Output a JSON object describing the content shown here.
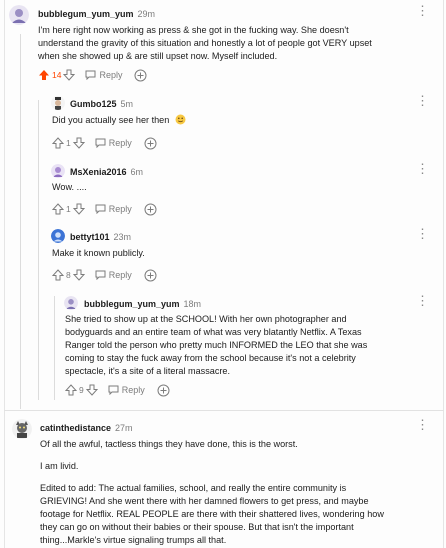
{
  "colors": {
    "upvote_active": "#ff4500",
    "meta": "#7c7c7c",
    "text": "#1c1c1c"
  },
  "icons": [
    "upvote-icon",
    "downvote-icon",
    "reply-bubble-icon",
    "award-icon",
    "more-options-icon"
  ],
  "comments": [
    {
      "user": "bubblegum_yum_yum",
      "age": "29m",
      "lines": [
        "I'm here right now working as press & she got in the fucking way. She doesn't",
        "understand the gravity of this situation and honestly a lot of people got VERY upset",
        "when she showed up & are still upset now. Myself included."
      ],
      "score": "14",
      "reply_label": "Reply"
    },
    {
      "user": "Gumbo125",
      "age": "5m",
      "lines": [
        "Did you actually see her then"
      ],
      "score": "1",
      "reply_label": "Reply"
    },
    {
      "user": "MsXenia2016",
      "age": "6m",
      "lines": [
        "Wow. ...."
      ],
      "score": "1",
      "reply_label": "Reply"
    },
    {
      "user": "bettyt101",
      "age": "23m",
      "lines": [
        "Make it known publicly."
      ],
      "score": "8",
      "reply_label": "Reply"
    },
    {
      "user": "bubblegum_yum_yum",
      "age": "18m",
      "lines": [
        "She tried to show up at the SCHOOL! With her own photographer and",
        "bodyguards and an entire team of what was very blatantly Netflix. A Texas",
        "Ranger told the person who pretty much INFORMED the LEO that she was",
        "coming to stay the fuck away from the school because it's not a celebrity",
        "spectacle, it's a site of a literal massacre."
      ],
      "score": "9",
      "reply_label": "Reply"
    },
    {
      "user": "catinthedistance",
      "age": "27m",
      "paragraphs": [
        "Of all the awful, tactless things they have done, this is the worst.",
        "I am livid."
      ],
      "lines": [
        "Edited to add: The actual families, school, and really the entire community is",
        "GRIEVING! And she went there with her damned flowers to get press, and maybe",
        "footage for Netflix. REAL PEOPLE are there with their shattered lives, wondering how",
        "they can go on without their babies or their spouse. But that isn't the important",
        "thing...Markle's virtue signaling trumps all that."
      ]
    }
  ]
}
